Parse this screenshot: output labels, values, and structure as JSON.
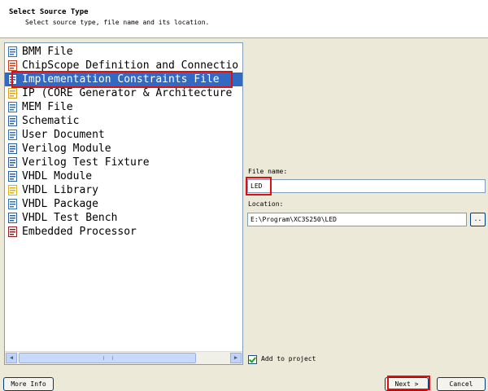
{
  "header": {
    "title": "Select Source Type",
    "description": "Select source type, file name and its location."
  },
  "source_types": [
    {
      "label": "BMM File",
      "icon": "bmm-file-icon"
    },
    {
      "label": "ChipScope Definition and Connectio",
      "icon": "chipscope-icon"
    },
    {
      "label": "Implementation Constraints File",
      "icon": "constraints-file-icon",
      "selected": true
    },
    {
      "label": "IP (CORE Generator & Architecture",
      "icon": "ip-core-icon"
    },
    {
      "label": "MEM File",
      "icon": "mem-file-icon"
    },
    {
      "label": "Schematic",
      "icon": "schematic-icon"
    },
    {
      "label": "User Document",
      "icon": "user-document-icon"
    },
    {
      "label": "Verilog Module",
      "icon": "verilog-module-icon"
    },
    {
      "label": "Verilog Test Fixture",
      "icon": "verilog-test-fixture-icon"
    },
    {
      "label": "VHDL Module",
      "icon": "vhdl-module-icon"
    },
    {
      "label": "VHDL Library",
      "icon": "vhdl-library-icon"
    },
    {
      "label": "VHDL Package",
      "icon": "vhdl-package-icon"
    },
    {
      "label": "VHDL Test Bench",
      "icon": "vhdl-test-bench-icon"
    },
    {
      "label": "Embedded Processor",
      "icon": "embedded-processor-icon"
    }
  ],
  "file_name": {
    "label": "File name:",
    "value": "LED"
  },
  "location": {
    "label": "Location:",
    "value": "E:\\Program\\XC3S250\\LED",
    "browse_label": ".."
  },
  "add_to_project": {
    "label": "Add to project",
    "checked": true
  },
  "buttons": {
    "more_info": "More Info",
    "next": "Next >",
    "cancel": "Cancel"
  },
  "colors": {
    "selection": "#316ac5",
    "highlight_box": "#e01010",
    "dialog_bg": "#ece9d8"
  }
}
